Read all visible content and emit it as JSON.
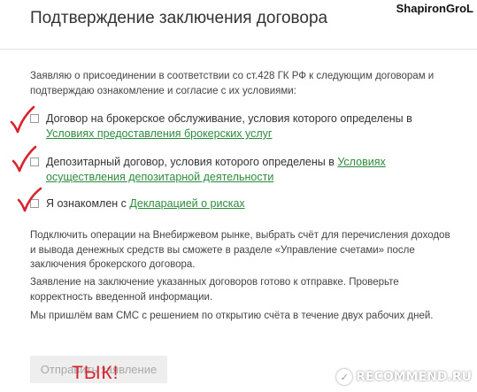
{
  "header": {
    "title": "Подтверждение заключения договора",
    "watermark_user": "ShapironGroL"
  },
  "intro": "Заявляю о присоединении в соответствии со ст.428 ГК РФ к следующим договорам и подтверждаю ознакомление и согласие с их условиями:",
  "options": [
    {
      "text": "Договор на брокерское обслуживание, условия которого определены в ",
      "link": "Условиях предоставления брокерских услуг",
      "checked": false
    },
    {
      "text": "Депозитарный договор, условия которого определены в ",
      "link": "Условиях осуществления депозитарной деятельности",
      "checked": false
    },
    {
      "text": "Я ознакомлен с ",
      "link": "Декларацией о рисках",
      "checked": false
    }
  ],
  "paragraphs": [
    "Подключить операции на Внебиржевом рынке, выбрать счёт для перечисления доходов и вывода денежных средств вы сможете в разделе «Управление счетами» после заключения брокерского договора.",
    "Заявление на заключение указанных договоров готово к отправке. Проверьте корректность введенной информации.",
    "Мы пришлём вам СМС с решением по открытию счёта в течение двух рабочих дней."
  ],
  "submit_label": "Отправить заявление",
  "annotation": {
    "text": "ТЫК!",
    "color": "#d9232d"
  },
  "site_watermark": "RECOMMEND.RU",
  "colors": {
    "link": "#2e8b3d",
    "check_annotation": "#d9232d"
  }
}
